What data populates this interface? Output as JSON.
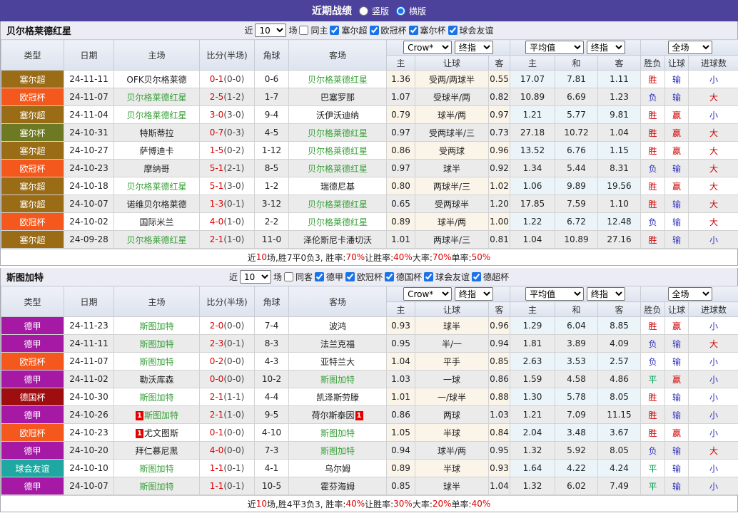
{
  "topbar": {
    "title": "近期战绩",
    "radios": [
      {
        "label": "竖版",
        "checked": false
      },
      {
        "label": "横版",
        "checked": true
      }
    ]
  },
  "colors": {
    "topbar_bg": "#4c419b",
    "win_red": "#d00000",
    "lose_blue": "#3333bb",
    "draw_green": "#00a050",
    "team_green": "#38a038",
    "score_red": "#e00000",
    "odd_col_bg": "#fbf4e9",
    "avg_col_bg": "#eaf4f9",
    "league_colors": {
      "塞尔超": "#9a6c16",
      "欧冠杯": "#f5581c",
      "塞尔杯": "#6d7a23",
      "德甲": "#a519a5",
      "德国杯": "#9e0d10",
      "球会友谊": "#1fa8a2"
    }
  },
  "header": {
    "cols": [
      "类型",
      "日期",
      "主场",
      "比分(半场)",
      "角球",
      "客场"
    ],
    "crow_select": "Crow*",
    "crow_idx_select": "终指",
    "avg_select": "平均值",
    "avg_idx_select": "终指",
    "scope_select": "全场",
    "sub": [
      "主",
      "让球",
      "客",
      "主",
      "和",
      "客",
      "胜负",
      "让球",
      "进球数"
    ]
  },
  "sections": [
    {
      "team": "贝尔格莱德红星",
      "filter": {
        "near": "近",
        "count": "10",
        "field": "场",
        "same": {
          "label": "同主",
          "checked": false
        },
        "leagues": [
          {
            "label": "塞尔超",
            "checked": true
          },
          {
            "label": "欧冠杯",
            "checked": true
          },
          {
            "label": "塞尔杯",
            "checked": true
          },
          {
            "label": "球会友谊",
            "checked": true
          }
        ]
      },
      "rows": [
        {
          "league": "塞尔超",
          "date": "24-11-11",
          "home": {
            "name": "OFK贝尔格莱德",
            "green": false
          },
          "score": "0-1",
          "half": "(0-0)",
          "corner": "0-6",
          "away": {
            "name": "贝尔格莱德红星",
            "green": true
          },
          "odds": [
            "1.36",
            "受两/两球半",
            "0.55"
          ],
          "avg": [
            "17.07",
            "7.81",
            "1.11"
          ],
          "res": [
            {
              "t": "胜",
              "c": "r"
            },
            {
              "t": "输",
              "c": "b"
            },
            {
              "t": "小",
              "c": "b"
            }
          ]
        },
        {
          "league": "欧冠杯",
          "date": "24-11-07",
          "home": {
            "name": "贝尔格莱德红星",
            "green": true
          },
          "score": "2-5",
          "half": "(1-2)",
          "corner": "1-7",
          "away": {
            "name": "巴塞罗那",
            "green": false
          },
          "odds": [
            "1.07",
            "受球半/两",
            "0.82"
          ],
          "avg": [
            "10.89",
            "6.69",
            "1.23"
          ],
          "res": [
            {
              "t": "负",
              "c": "b"
            },
            {
              "t": "输",
              "c": "b"
            },
            {
              "t": "大",
              "c": "r"
            }
          ]
        },
        {
          "league": "塞尔超",
          "date": "24-11-04",
          "home": {
            "name": "贝尔格莱德红星",
            "green": true
          },
          "score": "3-0",
          "half": "(3-0)",
          "corner": "9-4",
          "away": {
            "name": "沃伊沃迪纳",
            "green": false
          },
          "odds": [
            "0.79",
            "球半/两",
            "0.97"
          ],
          "avg": [
            "1.21",
            "5.77",
            "9.81"
          ],
          "res": [
            {
              "t": "胜",
              "c": "r"
            },
            {
              "t": "赢",
              "c": "r"
            },
            {
              "t": "小",
              "c": "b"
            }
          ]
        },
        {
          "league": "塞尔杯",
          "date": "24-10-31",
          "home": {
            "name": "特斯蒂拉",
            "green": false
          },
          "score": "0-7",
          "half": "(0-3)",
          "corner": "4-5",
          "away": {
            "name": "贝尔格莱德红星",
            "green": true
          },
          "odds": [
            "0.97",
            "受两球半/三",
            "0.73"
          ],
          "avg": [
            "27.18",
            "10.72",
            "1.04"
          ],
          "res": [
            {
              "t": "胜",
              "c": "r"
            },
            {
              "t": "赢",
              "c": "r"
            },
            {
              "t": "大",
              "c": "r"
            }
          ]
        },
        {
          "league": "塞尔超",
          "date": "24-10-27",
          "home": {
            "name": "萨博迪卡",
            "green": false
          },
          "score": "1-5",
          "half": "(0-2)",
          "corner": "1-12",
          "away": {
            "name": "贝尔格莱德红星",
            "green": true
          },
          "odds": [
            "0.86",
            "受两球",
            "0.96"
          ],
          "avg": [
            "13.52",
            "6.76",
            "1.15"
          ],
          "res": [
            {
              "t": "胜",
              "c": "r"
            },
            {
              "t": "赢",
              "c": "r"
            },
            {
              "t": "大",
              "c": "r"
            }
          ]
        },
        {
          "league": "欧冠杯",
          "date": "24-10-23",
          "home": {
            "name": "摩纳哥",
            "green": false
          },
          "score": "5-1",
          "half": "(2-1)",
          "corner": "8-5",
          "away": {
            "name": "贝尔格莱德红星",
            "green": true
          },
          "odds": [
            "0.97",
            "球半",
            "0.92"
          ],
          "avg": [
            "1.34",
            "5.44",
            "8.31"
          ],
          "res": [
            {
              "t": "负",
              "c": "b"
            },
            {
              "t": "输",
              "c": "b"
            },
            {
              "t": "大",
              "c": "r"
            }
          ]
        },
        {
          "league": "塞尔超",
          "date": "24-10-18",
          "home": {
            "name": "贝尔格莱德红星",
            "green": true
          },
          "score": "5-1",
          "half": "(3-0)",
          "corner": "1-2",
          "away": {
            "name": "瑞德尼基",
            "green": false
          },
          "odds": [
            "0.80",
            "两球半/三",
            "1.02"
          ],
          "avg": [
            "1.06",
            "9.89",
            "19.56"
          ],
          "res": [
            {
              "t": "胜",
              "c": "r"
            },
            {
              "t": "赢",
              "c": "r"
            },
            {
              "t": "大",
              "c": "r"
            }
          ]
        },
        {
          "league": "塞尔超",
          "date": "24-10-07",
          "home": {
            "name": "诺维贝尔格莱德",
            "green": false
          },
          "score": "1-3",
          "half": "(0-1)",
          "corner": "3-12",
          "away": {
            "name": "贝尔格莱德红星",
            "green": true
          },
          "odds": [
            "0.65",
            "受两球半",
            "1.20"
          ],
          "avg": [
            "17.85",
            "7.59",
            "1.10"
          ],
          "res": [
            {
              "t": "胜",
              "c": "r"
            },
            {
              "t": "输",
              "c": "b"
            },
            {
              "t": "大",
              "c": "r"
            }
          ]
        },
        {
          "league": "欧冠杯",
          "date": "24-10-02",
          "home": {
            "name": "国际米兰",
            "green": false
          },
          "score": "4-0",
          "half": "(1-0)",
          "corner": "2-2",
          "away": {
            "name": "贝尔格莱德红星",
            "green": true
          },
          "odds": [
            "0.89",
            "球半/两",
            "1.00"
          ],
          "avg": [
            "1.22",
            "6.72",
            "12.48"
          ],
          "res": [
            {
              "t": "负",
              "c": "b"
            },
            {
              "t": "输",
              "c": "b"
            },
            {
              "t": "大",
              "c": "r"
            }
          ]
        },
        {
          "league": "塞尔超",
          "date": "24-09-28",
          "home": {
            "name": "贝尔格莱德红星",
            "green": true
          },
          "score": "2-1",
          "half": "(1-0)",
          "corner": "11-0",
          "away": {
            "name": "泽伦斯尼卡潘切沃",
            "green": false
          },
          "odds": [
            "1.01",
            "两球半/三",
            "0.81"
          ],
          "avg": [
            "1.04",
            "10.89",
            "27.16"
          ],
          "res": [
            {
              "t": "胜",
              "c": "r"
            },
            {
              "t": "输",
              "c": "b"
            },
            {
              "t": "小",
              "c": "b"
            }
          ]
        }
      ],
      "summary": [
        {
          "t": "近",
          "red": false
        },
        {
          "t": "10",
          "red": true
        },
        {
          "t": "场,胜7平0负3, 胜率:",
          "red": false
        },
        {
          "t": "70%",
          "red": true
        },
        {
          "t": " 让胜率:",
          "red": false
        },
        {
          "t": "40%",
          "red": true
        },
        {
          "t": " 大率:",
          "red": false
        },
        {
          "t": "70%",
          "red": true
        },
        {
          "t": " 单率:",
          "red": false
        },
        {
          "t": "50%",
          "red": true
        }
      ]
    },
    {
      "team": "斯图加特",
      "filter": {
        "near": "近",
        "count": "10",
        "field": "场",
        "same": {
          "label": "同客",
          "checked": false
        },
        "leagues": [
          {
            "label": "德甲",
            "checked": true
          },
          {
            "label": "欧冠杯",
            "checked": true
          },
          {
            "label": "德国杯",
            "checked": true
          },
          {
            "label": "球会友谊",
            "checked": true
          },
          {
            "label": "德超杯",
            "checked": true
          }
        ]
      },
      "rows": [
        {
          "league": "德甲",
          "date": "24-11-23",
          "home": {
            "name": "斯图加特",
            "green": true
          },
          "score": "2-0",
          "half": "(0-0)",
          "corner": "7-4",
          "away": {
            "name": "波鸿",
            "green": false
          },
          "odds": [
            "0.93",
            "球半",
            "0.96"
          ],
          "avg": [
            "1.29",
            "6.04",
            "8.85"
          ],
          "res": [
            {
              "t": "胜",
              "c": "r"
            },
            {
              "t": "赢",
              "c": "r"
            },
            {
              "t": "小",
              "c": "b"
            }
          ]
        },
        {
          "league": "德甲",
          "date": "24-11-11",
          "home": {
            "name": "斯图加特",
            "green": true
          },
          "score": "2-3",
          "half": "(0-1)",
          "corner": "8-3",
          "away": {
            "name": "法兰克福",
            "green": false
          },
          "odds": [
            "0.95",
            "半/一",
            "0.94"
          ],
          "avg": [
            "1.81",
            "3.89",
            "4.09"
          ],
          "res": [
            {
              "t": "负",
              "c": "b"
            },
            {
              "t": "输",
              "c": "b"
            },
            {
              "t": "大",
              "c": "r"
            }
          ]
        },
        {
          "league": "欧冠杯",
          "date": "24-11-07",
          "home": {
            "name": "斯图加特",
            "green": true
          },
          "score": "0-2",
          "half": "(0-0)",
          "corner": "4-3",
          "away": {
            "name": "亚特兰大",
            "green": false
          },
          "odds": [
            "1.04",
            "平手",
            "0.85"
          ],
          "avg": [
            "2.63",
            "3.53",
            "2.57"
          ],
          "res": [
            {
              "t": "负",
              "c": "b"
            },
            {
              "t": "输",
              "c": "b"
            },
            {
              "t": "小",
              "c": "b"
            }
          ]
        },
        {
          "league": "德甲",
          "date": "24-11-02",
          "home": {
            "name": "勒沃库森",
            "green": false
          },
          "score": "0-0",
          "half": "(0-0)",
          "corner": "10-2",
          "away": {
            "name": "斯图加特",
            "green": true
          },
          "odds": [
            "1.03",
            "一球",
            "0.86"
          ],
          "avg": [
            "1.59",
            "4.58",
            "4.86"
          ],
          "res": [
            {
              "t": "平",
              "c": "g"
            },
            {
              "t": "赢",
              "c": "r"
            },
            {
              "t": "小",
              "c": "b"
            }
          ]
        },
        {
          "league": "德国杯",
          "date": "24-10-30",
          "home": {
            "name": "斯图加特",
            "green": true
          },
          "score": "2-1",
          "half": "(1-1)",
          "corner": "4-4",
          "away": {
            "name": "凯泽斯劳滕",
            "green": false
          },
          "odds": [
            "1.01",
            "一/球半",
            "0.88"
          ],
          "avg": [
            "1.30",
            "5.78",
            "8.05"
          ],
          "res": [
            {
              "t": "胜",
              "c": "r"
            },
            {
              "t": "输",
              "c": "b"
            },
            {
              "t": "小",
              "c": "b"
            }
          ]
        },
        {
          "league": "德甲",
          "date": "24-10-26",
          "home": {
            "name": "斯图加特",
            "green": true,
            "card": "1",
            "card_after": false
          },
          "score": "2-1",
          "half": "(1-0)",
          "corner": "9-5",
          "away": {
            "name": "荷尔斯泰因",
            "green": false,
            "card": "1",
            "card_after": true
          },
          "odds": [
            "0.86",
            "两球",
            "1.03"
          ],
          "avg": [
            "1.21",
            "7.09",
            "11.15"
          ],
          "res": [
            {
              "t": "胜",
              "c": "r"
            },
            {
              "t": "输",
              "c": "b"
            },
            {
              "t": "小",
              "c": "b"
            }
          ]
        },
        {
          "league": "欧冠杯",
          "date": "24-10-23",
          "home": {
            "name": "尤文图斯",
            "green": false,
            "card": "1",
            "card_after": false
          },
          "score": "0-1",
          "half": "(0-0)",
          "corner": "4-10",
          "away": {
            "name": "斯图加特",
            "green": true
          },
          "odds": [
            "1.05",
            "半球",
            "0.84"
          ],
          "avg": [
            "2.04",
            "3.48",
            "3.67"
          ],
          "res": [
            {
              "t": "胜",
              "c": "r"
            },
            {
              "t": "赢",
              "c": "r"
            },
            {
              "t": "小",
              "c": "b"
            }
          ]
        },
        {
          "league": "德甲",
          "date": "24-10-20",
          "home": {
            "name": "拜仁慕尼黑",
            "green": false
          },
          "score": "4-0",
          "half": "(0-0)",
          "corner": "7-3",
          "away": {
            "name": "斯图加特",
            "green": true
          },
          "odds": [
            "0.94",
            "球半/两",
            "0.95"
          ],
          "avg": [
            "1.32",
            "5.92",
            "8.05"
          ],
          "res": [
            {
              "t": "负",
              "c": "b"
            },
            {
              "t": "输",
              "c": "b"
            },
            {
              "t": "大",
              "c": "r"
            }
          ]
        },
        {
          "league": "球会友谊",
          "date": "24-10-10",
          "home": {
            "name": "斯图加特",
            "green": true
          },
          "score": "1-1",
          "half": "(0-1)",
          "corner": "4-1",
          "away": {
            "name": "乌尔姆",
            "green": false
          },
          "odds": [
            "0.89",
            "半球",
            "0.93"
          ],
          "avg": [
            "1.64",
            "4.22",
            "4.24"
          ],
          "res": [
            {
              "t": "平",
              "c": "g"
            },
            {
              "t": "输",
              "c": "b"
            },
            {
              "t": "小",
              "c": "b"
            }
          ]
        },
        {
          "league": "德甲",
          "date": "24-10-07",
          "home": {
            "name": "斯图加特",
            "green": true
          },
          "score": "1-1",
          "half": "(0-1)",
          "corner": "10-5",
          "away": {
            "name": "霍芬海姆",
            "green": false
          },
          "odds": [
            "0.85",
            "球半",
            "1.04"
          ],
          "avg": [
            "1.32",
            "6.02",
            "7.49"
          ],
          "res": [
            {
              "t": "平",
              "c": "g"
            },
            {
              "t": "输",
              "c": "b"
            },
            {
              "t": "小",
              "c": "b"
            }
          ]
        }
      ],
      "summary": [
        {
          "t": "近",
          "red": false
        },
        {
          "t": "10",
          "red": true
        },
        {
          "t": "场,胜4平3负3, 胜率:",
          "red": false
        },
        {
          "t": "40%",
          "red": true
        },
        {
          "t": " 让胜率:",
          "red": false
        },
        {
          "t": "30%",
          "red": true
        },
        {
          "t": " 大率:",
          "red": false
        },
        {
          "t": "20%",
          "red": true
        },
        {
          "t": " 单率:",
          "red": false
        },
        {
          "t": "40%",
          "red": true
        }
      ]
    }
  ]
}
